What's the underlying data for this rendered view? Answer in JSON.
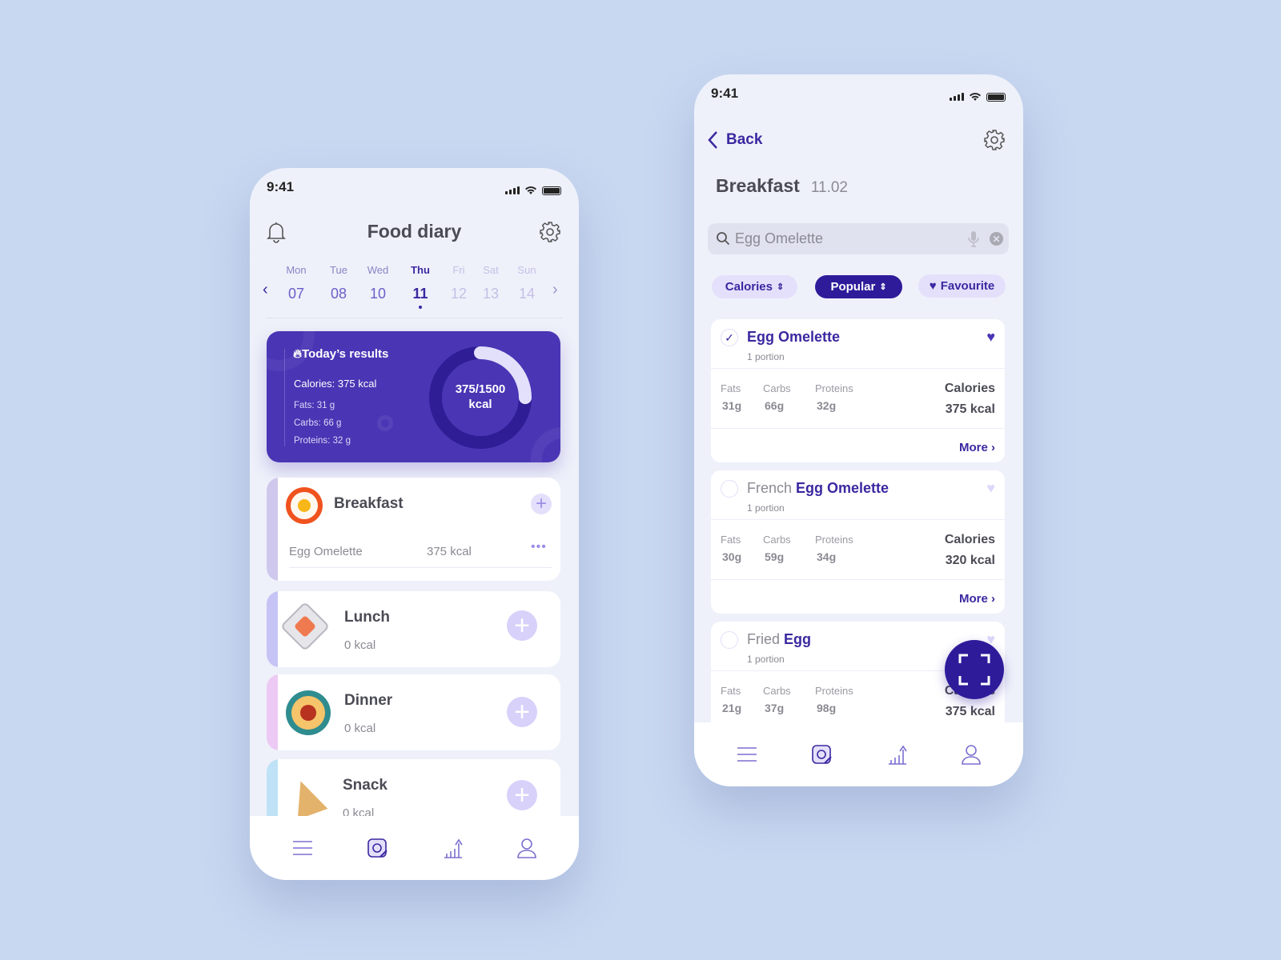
{
  "colors": {
    "accent": "#3a28a0",
    "card_purple": "#4a35b4",
    "light_purple": "#e4e0fb",
    "background": "#c9d8f1"
  },
  "left": {
    "status_time": "9:41",
    "header": {
      "title": "Food diary",
      "left_icon": "bell-icon",
      "right_icon": "gear-icon"
    },
    "days": [
      {
        "label": "Mon",
        "num": "07",
        "state": "past"
      },
      {
        "label": "Tue",
        "num": "08",
        "state": "past"
      },
      {
        "label": "Wed",
        "num": "10",
        "state": "past"
      },
      {
        "label": "Thu",
        "num": "11",
        "state": "active"
      },
      {
        "label": "Fri",
        "num": "12",
        "state": "future"
      },
      {
        "label": "Sat",
        "num": "13",
        "state": "future"
      },
      {
        "label": "Sun",
        "num": "14",
        "state": "future"
      }
    ],
    "results": {
      "title": "Today’s  results",
      "calories": "Calories: 375 kcal",
      "fats": "Fats: 31 g",
      "carbs": "Carbs: 66 g",
      "proteins": "Proteins: 32 g",
      "ring_value": "375/1500",
      "ring_unit": "kcal",
      "progress": 0.25
    },
    "meals": [
      {
        "name": "Breakfast",
        "item": "Egg Omelette",
        "item_kcal": "375 kcal",
        "bar": "#cfc8ec"
      },
      {
        "name": "Lunch",
        "kcal": "0 kcal",
        "bar": "#c6c3f5"
      },
      {
        "name": "Dinner",
        "kcal": "0 kcal",
        "bar": "#eccaf3"
      },
      {
        "name": "Snack",
        "kcal": "0 kcal",
        "bar": "#bfe2f6"
      }
    ],
    "nav": [
      "menu-icon",
      "diary-icon",
      "stats-icon",
      "profile-icon"
    ]
  },
  "right": {
    "status_time": "9:41",
    "back": "Back",
    "title": "Breakfast",
    "date": "11.02",
    "search": {
      "value": "Egg Omelette"
    },
    "chips": {
      "calories": "Calories",
      "popular": "Popular",
      "favourite": "Favourite"
    },
    "labels": {
      "fats": "Fats",
      "carbs": "Carbs",
      "proteins": "Proteins",
      "calories": "Calories",
      "more": "More"
    },
    "foods": [
      {
        "prefix": "",
        "name": "Egg Omelette",
        "portion": "1 portion",
        "fats": "31g",
        "carbs": "66g",
        "proteins": "32g",
        "kcal": "375 kcal",
        "checked": true,
        "favourite": true
      },
      {
        "prefix": "French ",
        "name": "Egg Omelette",
        "portion": "1 portion",
        "fats": "30g",
        "carbs": "59g",
        "proteins": "34g",
        "kcal": "320 kcal",
        "checked": false,
        "favourite": false
      },
      {
        "prefix": "Fried ",
        "name": "Egg",
        "portion": "1 portion",
        "fats": "21g",
        "carbs": "37g",
        "proteins": "98g",
        "kcal": "375 kcal",
        "checked": false,
        "favourite": false
      }
    ]
  }
}
